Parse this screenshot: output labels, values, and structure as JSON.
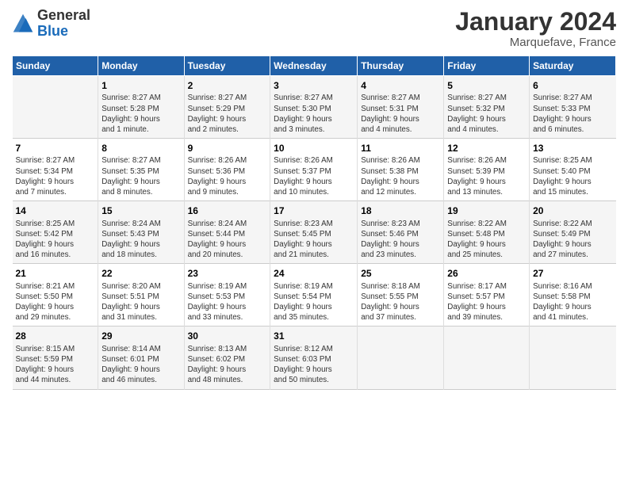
{
  "header": {
    "logo_general": "General",
    "logo_blue": "Blue",
    "month_title": "January 2024",
    "location": "Marquefave, France"
  },
  "days_of_week": [
    "Sunday",
    "Monday",
    "Tuesday",
    "Wednesday",
    "Thursday",
    "Friday",
    "Saturday"
  ],
  "weeks": [
    [
      {
        "day": "",
        "info": ""
      },
      {
        "day": "1",
        "info": "Sunrise: 8:27 AM\nSunset: 5:28 PM\nDaylight: 9 hours\nand 1 minute."
      },
      {
        "day": "2",
        "info": "Sunrise: 8:27 AM\nSunset: 5:29 PM\nDaylight: 9 hours\nand 2 minutes."
      },
      {
        "day": "3",
        "info": "Sunrise: 8:27 AM\nSunset: 5:30 PM\nDaylight: 9 hours\nand 3 minutes."
      },
      {
        "day": "4",
        "info": "Sunrise: 8:27 AM\nSunset: 5:31 PM\nDaylight: 9 hours\nand 4 minutes."
      },
      {
        "day": "5",
        "info": "Sunrise: 8:27 AM\nSunset: 5:32 PM\nDaylight: 9 hours\nand 4 minutes."
      },
      {
        "day": "6",
        "info": "Sunrise: 8:27 AM\nSunset: 5:33 PM\nDaylight: 9 hours\nand 6 minutes."
      }
    ],
    [
      {
        "day": "7",
        "info": "Sunrise: 8:27 AM\nSunset: 5:34 PM\nDaylight: 9 hours\nand 7 minutes."
      },
      {
        "day": "8",
        "info": "Sunrise: 8:27 AM\nSunset: 5:35 PM\nDaylight: 9 hours\nand 8 minutes."
      },
      {
        "day": "9",
        "info": "Sunrise: 8:26 AM\nSunset: 5:36 PM\nDaylight: 9 hours\nand 9 minutes."
      },
      {
        "day": "10",
        "info": "Sunrise: 8:26 AM\nSunset: 5:37 PM\nDaylight: 9 hours\nand 10 minutes."
      },
      {
        "day": "11",
        "info": "Sunrise: 8:26 AM\nSunset: 5:38 PM\nDaylight: 9 hours\nand 12 minutes."
      },
      {
        "day": "12",
        "info": "Sunrise: 8:26 AM\nSunset: 5:39 PM\nDaylight: 9 hours\nand 13 minutes."
      },
      {
        "day": "13",
        "info": "Sunrise: 8:25 AM\nSunset: 5:40 PM\nDaylight: 9 hours\nand 15 minutes."
      }
    ],
    [
      {
        "day": "14",
        "info": "Sunrise: 8:25 AM\nSunset: 5:42 PM\nDaylight: 9 hours\nand 16 minutes."
      },
      {
        "day": "15",
        "info": "Sunrise: 8:24 AM\nSunset: 5:43 PM\nDaylight: 9 hours\nand 18 minutes."
      },
      {
        "day": "16",
        "info": "Sunrise: 8:24 AM\nSunset: 5:44 PM\nDaylight: 9 hours\nand 20 minutes."
      },
      {
        "day": "17",
        "info": "Sunrise: 8:23 AM\nSunset: 5:45 PM\nDaylight: 9 hours\nand 21 minutes."
      },
      {
        "day": "18",
        "info": "Sunrise: 8:23 AM\nSunset: 5:46 PM\nDaylight: 9 hours\nand 23 minutes."
      },
      {
        "day": "19",
        "info": "Sunrise: 8:22 AM\nSunset: 5:48 PM\nDaylight: 9 hours\nand 25 minutes."
      },
      {
        "day": "20",
        "info": "Sunrise: 8:22 AM\nSunset: 5:49 PM\nDaylight: 9 hours\nand 27 minutes."
      }
    ],
    [
      {
        "day": "21",
        "info": "Sunrise: 8:21 AM\nSunset: 5:50 PM\nDaylight: 9 hours\nand 29 minutes."
      },
      {
        "day": "22",
        "info": "Sunrise: 8:20 AM\nSunset: 5:51 PM\nDaylight: 9 hours\nand 31 minutes."
      },
      {
        "day": "23",
        "info": "Sunrise: 8:19 AM\nSunset: 5:53 PM\nDaylight: 9 hours\nand 33 minutes."
      },
      {
        "day": "24",
        "info": "Sunrise: 8:19 AM\nSunset: 5:54 PM\nDaylight: 9 hours\nand 35 minutes."
      },
      {
        "day": "25",
        "info": "Sunrise: 8:18 AM\nSunset: 5:55 PM\nDaylight: 9 hours\nand 37 minutes."
      },
      {
        "day": "26",
        "info": "Sunrise: 8:17 AM\nSunset: 5:57 PM\nDaylight: 9 hours\nand 39 minutes."
      },
      {
        "day": "27",
        "info": "Sunrise: 8:16 AM\nSunset: 5:58 PM\nDaylight: 9 hours\nand 41 minutes."
      }
    ],
    [
      {
        "day": "28",
        "info": "Sunrise: 8:15 AM\nSunset: 5:59 PM\nDaylight: 9 hours\nand 44 minutes."
      },
      {
        "day": "29",
        "info": "Sunrise: 8:14 AM\nSunset: 6:01 PM\nDaylight: 9 hours\nand 46 minutes."
      },
      {
        "day": "30",
        "info": "Sunrise: 8:13 AM\nSunset: 6:02 PM\nDaylight: 9 hours\nand 48 minutes."
      },
      {
        "day": "31",
        "info": "Sunrise: 8:12 AM\nSunset: 6:03 PM\nDaylight: 9 hours\nand 50 minutes."
      },
      {
        "day": "",
        "info": ""
      },
      {
        "day": "",
        "info": ""
      },
      {
        "day": "",
        "info": ""
      }
    ]
  ]
}
